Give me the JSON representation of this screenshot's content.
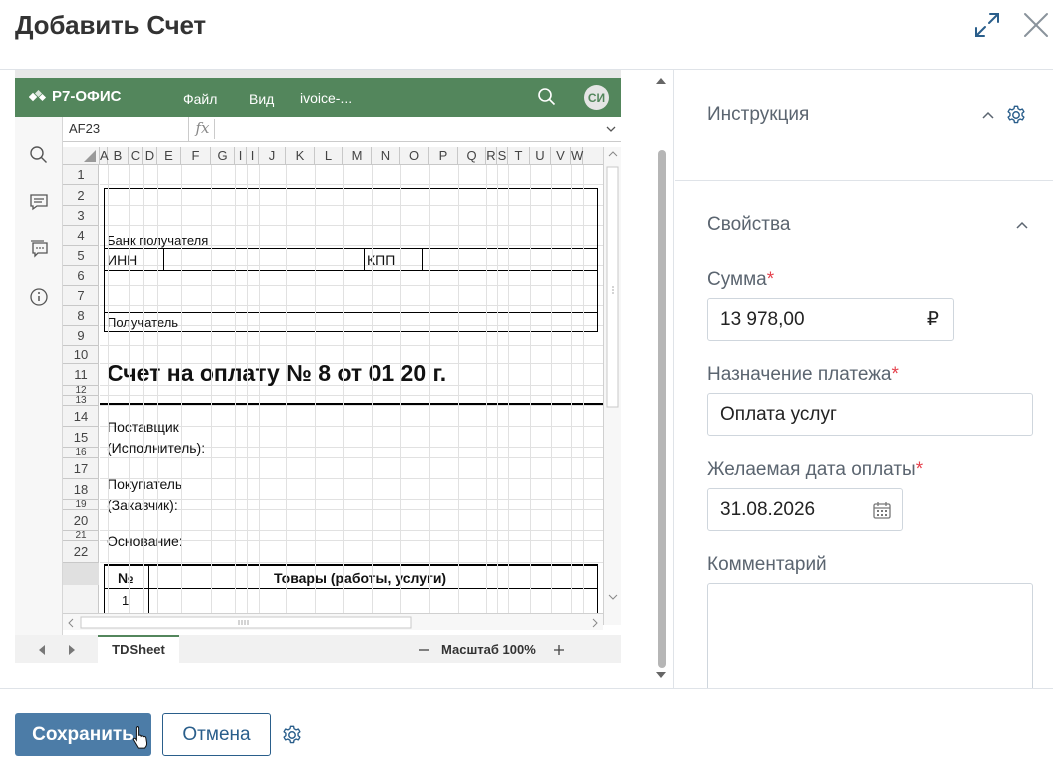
{
  "modal": {
    "title": "Добавить Счет",
    "expand_icon": "expand-icon",
    "close_icon": "close-icon"
  },
  "editor": {
    "brand": "Р7-ОФИС",
    "menu": [
      "Файл",
      "Вид"
    ],
    "doc_name": "ivoice-...",
    "avatar": "СИ",
    "cell_ref": "AF23",
    "fx": "fx",
    "columns": [
      "A",
      "B",
      "C",
      "D",
      "E",
      "F",
      "G",
      "I",
      "I",
      "J",
      "K",
      "L",
      "M",
      "N",
      "O",
      "P",
      "Q",
      "R",
      "S",
      "T",
      "U",
      "V",
      "W"
    ],
    "rows": [
      "1",
      "2",
      "3",
      "4",
      "5",
      "6",
      "7",
      "8",
      "9",
      "10",
      "11",
      "12",
      "13",
      "14",
      "15",
      "16",
      "17",
      "18",
      "19",
      "20",
      "21",
      "22"
    ],
    "cells": {
      "bank": "Банк получателя",
      "inn": "ИНН",
      "kpp": "КПП",
      "recipient": "Получатель",
      "invoice_title": "Счет на оплату № 8  от 01       20   г.",
      "supplier_1": "Поставщик",
      "supplier_2": "(Исполнитель):",
      "buyer_1": "Покупатель",
      "buyer_2": "(Заказчик):",
      "basis": "Основание:",
      "col_no": "№",
      "col_goods": "Товары (работы, услуги)",
      "row_1": "1"
    },
    "sheet_tab": "TDSheet",
    "zoom": "Масштаб 100%"
  },
  "side": {
    "instruction_title": "Инструкция",
    "properties_title": "Свойства",
    "amount_label": "Сумма",
    "amount_value": "13 978,00",
    "currency": "₽",
    "purpose_label": "Назначение платежа",
    "purpose_value": "Оплата услуг",
    "date_label": "Желаемая дата оплаты",
    "date_value": "31.08.2026",
    "comment_label": "Комментарий",
    "comment_value": "",
    "required_mark": "*"
  },
  "footer": {
    "save_label": "Сохранить",
    "cancel_label": "Отмена"
  },
  "colors": {
    "editor_green": "#53865c",
    "primary": "#4c7ca7",
    "link": "#2a5e8b",
    "required": "#e5424d"
  }
}
